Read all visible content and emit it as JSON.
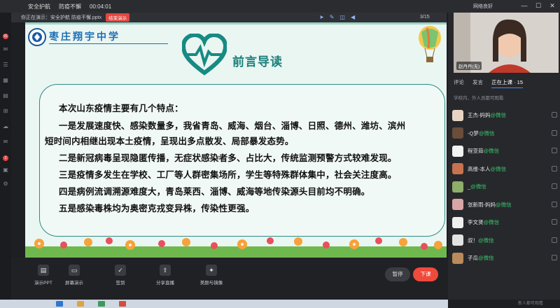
{
  "titlebar": {
    "app": "安全护航",
    "doc": "防疫不懈",
    "timer": "00:04:01",
    "network": "网络良好",
    "min": "—",
    "max": "☐",
    "close": "✕"
  },
  "present_bar": {
    "label": "你正在演示：安全护航 防疫不懈.pptx",
    "stop_label": "结束演示",
    "page": "3/15"
  },
  "slide": {
    "school": "枣庄翔宇中学",
    "heading": "前言导读",
    "paragraphs": [
      "本次山东疫情主要有几个特点：",
      "一是发展速度快、感染数量多，我省青岛、威海、烟台、淄博、日照、德州、潍坊、滨州",
      "短时间内相继出现本土疫情，呈现出多点散发、局部暴发态势。",
      "二是新冠病毒呈现隐匿传播，无症状感染者多、占比大，传统监测预警方式较难发现。",
      "三是疫情多发生在学校、工厂等人群密集场所，学生等特殊群体集中，社会关注度高。",
      "四是病例流调溯源难度大，青岛莱西、淄博、威海等地传染源头目前均不明确。",
      "五是感染毒株均为奥密克戎变异株，传染性更强。"
    ]
  },
  "controls": {
    "buttons": [
      {
        "label": "演示PPT",
        "icon": "ppt-icon"
      },
      {
        "label": "屏幕演示",
        "icon": "screen-icon"
      },
      {
        "label": "签到",
        "icon": "checkin-icon"
      },
      {
        "label": "分享直播",
        "icon": "share-icon"
      },
      {
        "label": "美颜与镜像",
        "icon": "beauty-icon"
      }
    ],
    "pause": "暂停",
    "end": "下课"
  },
  "right_panel": {
    "camera_name": "赵丹丹(无)",
    "tabs": [
      "评论",
      "发言",
      "正在上课 · 15"
    ],
    "hint": "学校内、外人员都可观看",
    "users": [
      {
        "name": "王杰-妈妈",
        "wx": "@微信"
      },
      {
        "name": "-Q梦",
        "wx": "@微信"
      },
      {
        "name": "程亚茹",
        "wx": "@微信"
      },
      {
        "name": "高维-本人",
        "wx": "@微信"
      },
      {
        "name": "_",
        "wx": "@微信"
      },
      {
        "name": "张新雨-妈妈",
        "wx": "@微信"
      },
      {
        "name": "李文贤",
        "wx": "@微信"
      },
      {
        "name": "叔！",
        "wx": "@微信"
      },
      {
        "name": "子瓜",
        "wx": "@微信"
      }
    ],
    "chat_placeholder": "新人都可观看"
  },
  "colors": {
    "accent": "#1b7f7a",
    "end": "#ef4a3c",
    "wx_green": "#39c46b"
  }
}
